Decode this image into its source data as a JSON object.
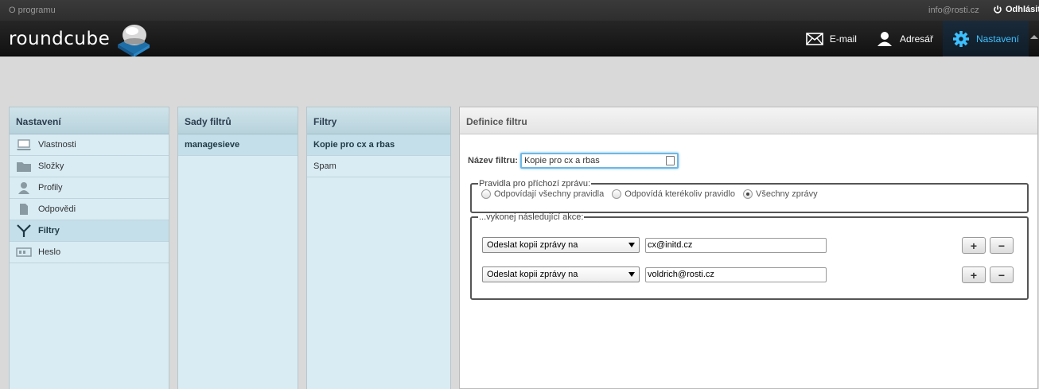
{
  "topline": {
    "about": "O programu",
    "user": "info@rosti.cz",
    "logout": "Odhlásit"
  },
  "logo": {
    "text": "roundcube"
  },
  "taskbar": [
    {
      "label": "E-mail",
      "icon": "envelope-icon"
    },
    {
      "label": "Adresář",
      "icon": "person-icon"
    },
    {
      "label": "Nastavení",
      "icon": "gear-icon"
    }
  ],
  "settings": {
    "title": "Nastavení",
    "items": [
      {
        "label": "Vlastnosti",
        "icon": "laptop-icon"
      },
      {
        "label": "Složky",
        "icon": "folder-icon"
      },
      {
        "label": "Profily",
        "icon": "user-icon"
      },
      {
        "label": "Odpovědi",
        "icon": "document-icon"
      },
      {
        "label": "Filtry",
        "icon": "filter-icon",
        "selected": true
      },
      {
        "label": "Heslo",
        "icon": "password-icon"
      }
    ]
  },
  "filter_sets": {
    "title": "Sady filtrů",
    "items": [
      {
        "label": "managesieve",
        "selected": true
      }
    ]
  },
  "filters": {
    "title": "Filtry",
    "items": [
      {
        "label": "Kopie pro cx a rbas",
        "selected": true
      },
      {
        "label": "Spam"
      }
    ]
  },
  "definition": {
    "title": "Definice filtru",
    "name_label": "Název filtru:",
    "name_value": "Kopie pro cx a rbas",
    "rules_legend": "Pravidla pro příchozí zprávu:",
    "rules_options": [
      {
        "label": "Odpovídají všechny pravidla",
        "checked": false
      },
      {
        "label": "Odpovídá kterékoliv pravidlo",
        "checked": false
      },
      {
        "label": "Všechny zprávy",
        "checked": true
      }
    ],
    "actions_legend": "...vykonej následující akce:",
    "actions": [
      {
        "type": "Odeslat kopii zprávy na",
        "value": "cx@initd.cz"
      },
      {
        "type": "Odeslat kopii zprávy na",
        "value": "voldrich@rosti.cz"
      }
    ],
    "add_label": "+",
    "remove_label": "−"
  }
}
